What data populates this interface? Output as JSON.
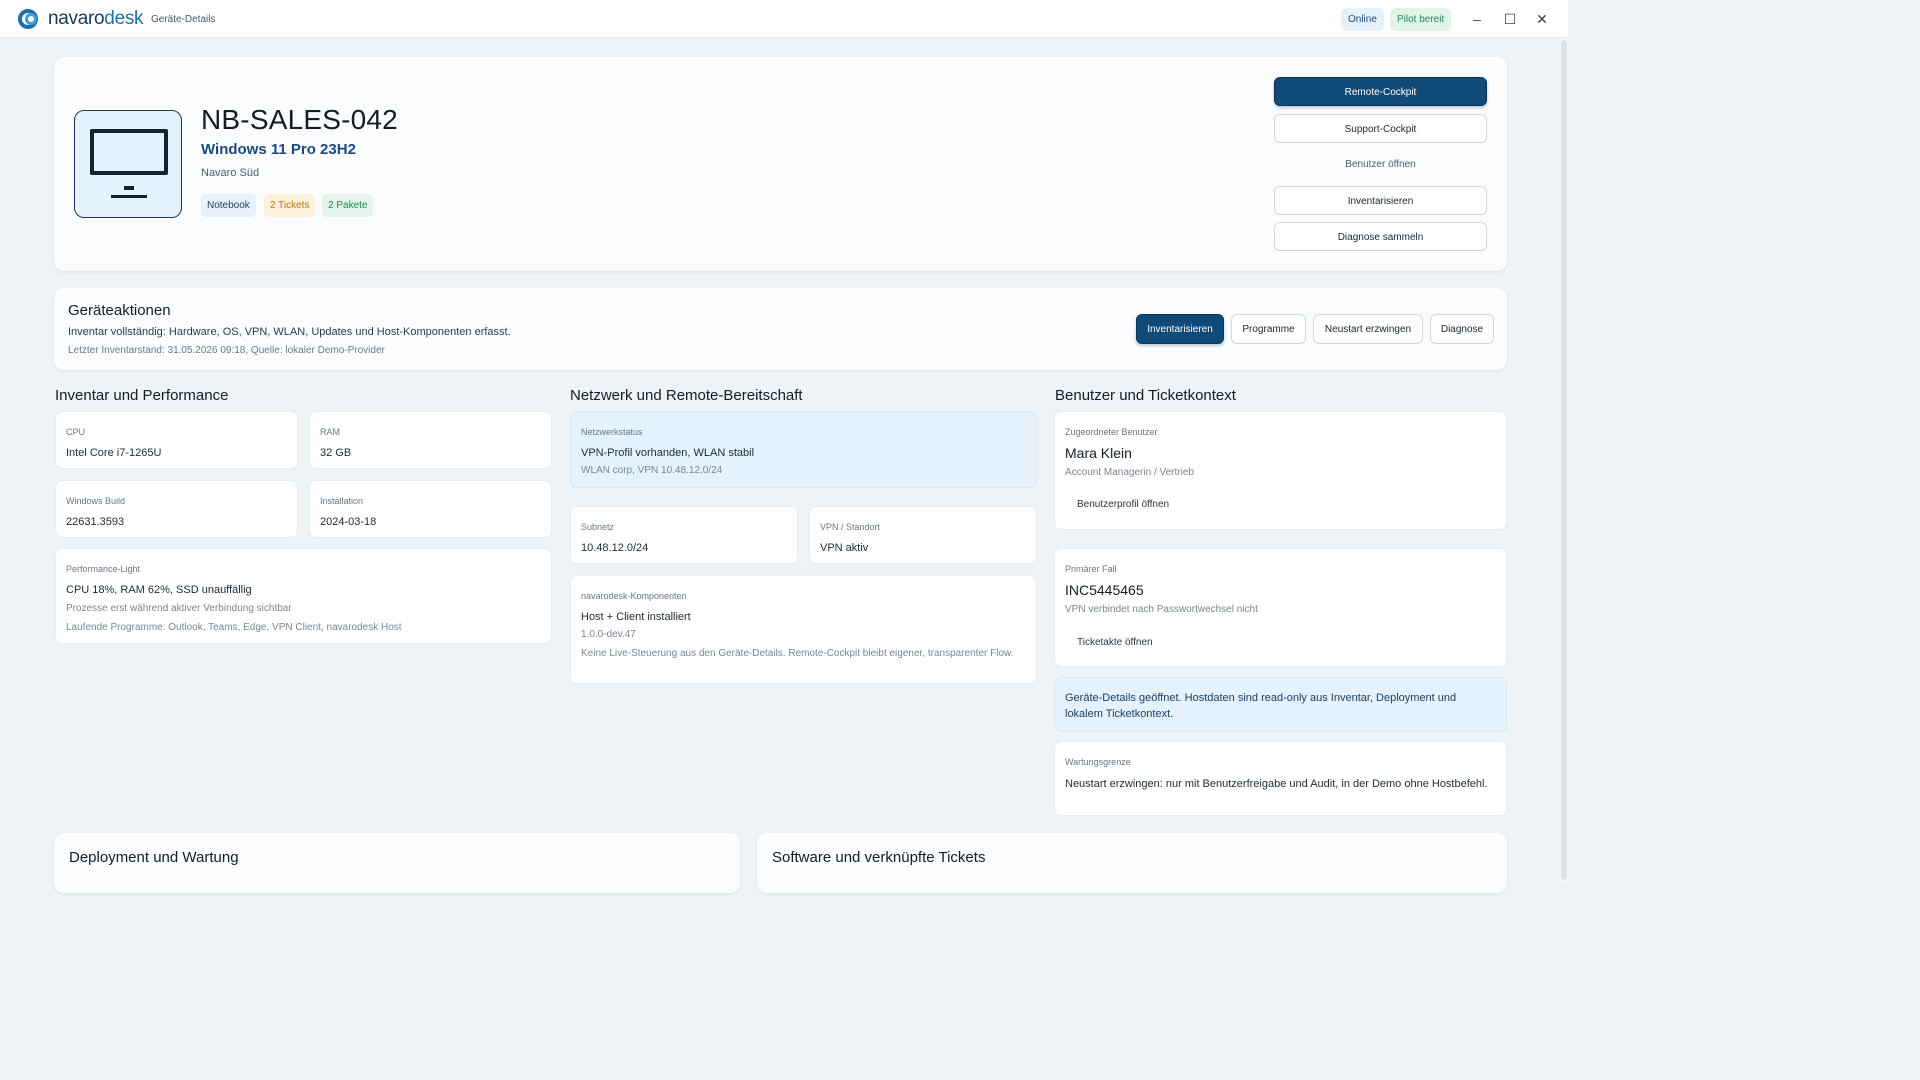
{
  "app": {
    "logo_main": "navaro",
    "logo_accent": "desk",
    "subtitle": "Geräte-Details",
    "status_online": "Online",
    "status_pilot": "Pilot bereit",
    "window_minimize": "–",
    "window_maximize": "☐",
    "window_close": "✕"
  },
  "device": {
    "name": "NB-SALES-042",
    "os": "Windows 11 Pro 23H2",
    "tenant": "Navaro Süd",
    "badges": {
      "type": "Notebook",
      "tickets": "2 Tickets",
      "packages": "2 Pakete"
    },
    "icon": "monitor-icon"
  },
  "hero_actions": {
    "remote_cockpit": "Remote-Cockpit",
    "support_cockpit": "Support-Cockpit",
    "open_user": "Benutzer öffnen",
    "inventory": "Inventarisieren",
    "diagnose_collect": "Diagnose sammeln"
  },
  "device_actions": {
    "title": "Geräteaktionen",
    "description": "Inventar vollständig: Hardware, OS, VPN, WLAN, Updates und Host-Komponenten erfasst.",
    "meta": "Letzter Inventarstand: 31.05.2026 09:18, Quelle: lokaler Demo-Provider",
    "buttons": {
      "inventory": "Inventarisieren",
      "programs": "Programme",
      "restart": "Neustart erzwingen",
      "diagnose": "Diagnose"
    }
  },
  "inventory": {
    "title": "Inventar und Performance",
    "cpu": {
      "label": "CPU",
      "value": "Intel Core i7-1265U"
    },
    "ram": {
      "label": "RAM",
      "value": "32 GB"
    },
    "build": {
      "label": "Windows Build",
      "value": "22631.3593"
    },
    "install": {
      "label": "Installation",
      "value": "2024-03-18"
    },
    "performance": {
      "label": "Performance-Light",
      "value": "CPU 18%, RAM 62%, SSD unauffällig",
      "note": "Prozesse erst während aktiver Verbindung sichtbar",
      "programs": "Laufende Programme: Outlook, Teams, Edge, VPN Client, navarodesk Host"
    }
  },
  "network": {
    "title": "Netzwerk und Remote-Bereitschaft",
    "status": {
      "label": "Netzwerkstatus",
      "value": "VPN-Profil vorhanden, WLAN stabil",
      "detail": "WLAN corp, VPN 10.48.12.0/24"
    },
    "subnet": {
      "label": "Subnetz",
      "value": "10.48.12.0/24"
    },
    "vpn": {
      "label": "VPN / Standort",
      "value": "VPN aktiv"
    },
    "components": {
      "label": "navarodesk-Komponenten",
      "value": "Host + Client installiert",
      "version": "1.0.0-dev.47",
      "note": "Keine Live-Steuerung aus den Geräte-Details. Remote-Cockpit bleibt eigener, transparenter Flow."
    }
  },
  "user_context": {
    "title": "Benutzer und Ticketkontext",
    "user": {
      "label": "Zugeordneter Benutzer",
      "name": "Mara Klein",
      "role": "Account Managerin / Vertrieb",
      "link": "Benutzerprofil öffnen"
    },
    "case": {
      "label": "Primärer Fall",
      "id": "INC5445465",
      "summary": "VPN verbindet nach Passwortwechsel nicht",
      "link": "Ticketakte öffnen"
    },
    "info": "Geräte-Details geöffnet. Hostdaten sind read-only aus Inventar, Deployment und lokalem Ticketkontext.",
    "maintenance": {
      "label": "Wartungsgrenze",
      "value": "Neustart erzwingen: nur mit Benutzerfreigabe und Audit, in der Demo ohne Hostbefehl."
    }
  },
  "bottom": {
    "deploy_title": "Deployment und Wartung",
    "software_title": "Software und verknüpfte Tickets"
  }
}
